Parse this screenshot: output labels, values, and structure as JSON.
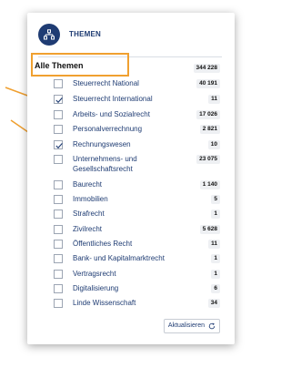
{
  "panel": {
    "title": "THEMEN",
    "title_icon": "sitemap-icon",
    "all_label": "Alle Themen",
    "all_count": "344 228",
    "update_label": "Aktualisieren",
    "update_icon": "refresh-icon"
  },
  "items": [
    {
      "label": "Steuerrecht National",
      "count": "40 191",
      "checked": false
    },
    {
      "label": "Steuerrecht International",
      "count": "11",
      "checked": true
    },
    {
      "label": "Arbeits- und Sozialrecht",
      "count": "17 026",
      "checked": false
    },
    {
      "label": "Personalverrechnung",
      "count": "2 821",
      "checked": false
    },
    {
      "label": "Rechnungswesen",
      "count": "10",
      "checked": true
    },
    {
      "label_line1": "Unternehmens- und",
      "label_line2": "Gesellschaftsrecht",
      "count": "23 075",
      "checked": false
    },
    {
      "label": "Baurecht",
      "count": "1 140",
      "checked": false
    },
    {
      "label": "Immobilien",
      "count": "5",
      "checked": false
    },
    {
      "label": "Strafrecht",
      "count": "1",
      "checked": false
    },
    {
      "label": "Zivilrecht",
      "count": "5 628",
      "checked": false
    },
    {
      "label": "Öffentliches Recht",
      "count": "11",
      "checked": false
    },
    {
      "label": "Bank- und Kapitalmarktrecht",
      "count": "1",
      "checked": false
    },
    {
      "label": "Vertragsrecht",
      "count": "1",
      "checked": false
    },
    {
      "label": "Digitalisierung",
      "count": "6",
      "checked": false
    },
    {
      "label": "Linde Wissenschaft",
      "count": "34",
      "checked": false
    }
  ],
  "colors": {
    "accent": "#1f3c73",
    "highlight": "#f0a030"
  }
}
